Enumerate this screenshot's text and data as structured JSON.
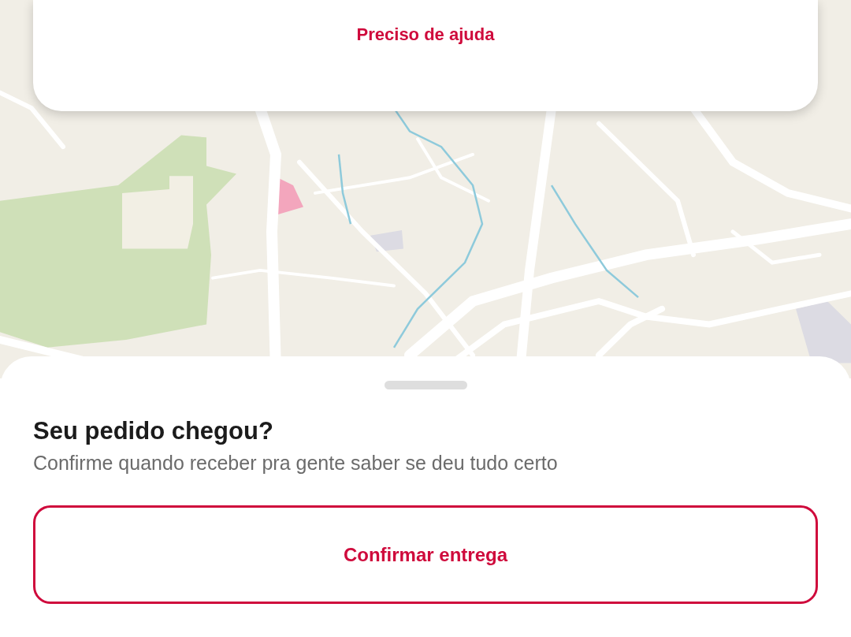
{
  "help_card": {
    "link": "Preciso de ajuda"
  },
  "sheet": {
    "title": "Seu pedido chegou?",
    "subtitle": "Confirme quando receber pra gente saber se deu tudo certo",
    "button": "Confirmar entrega"
  }
}
